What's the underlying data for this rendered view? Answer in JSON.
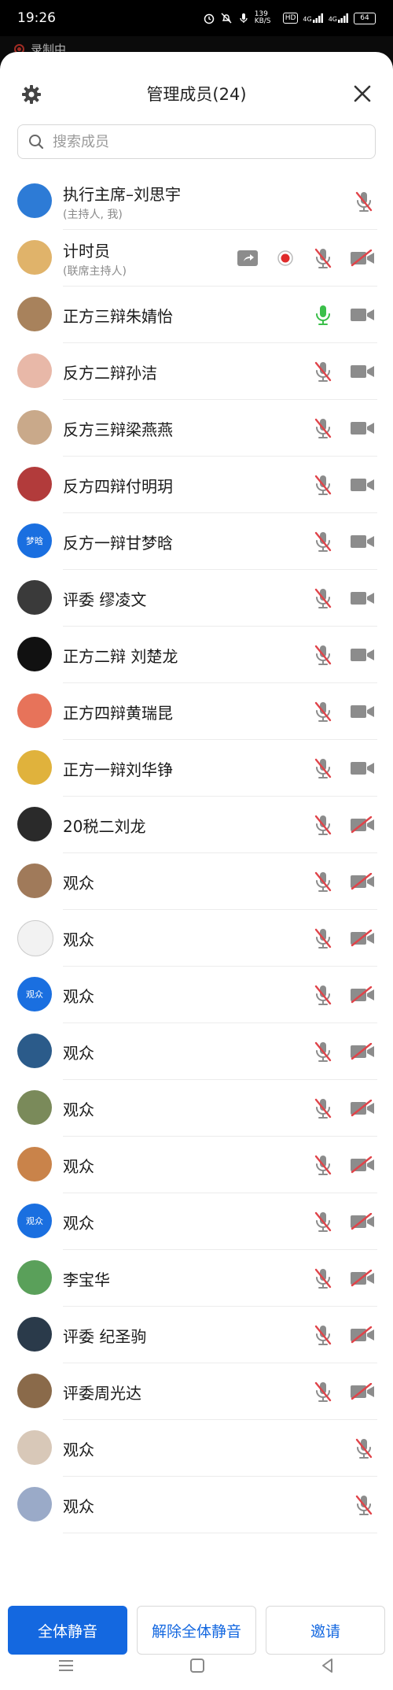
{
  "status_bar": {
    "time": "19:26",
    "net_speed": "139 KB/S",
    "hd": "HD",
    "sig1": "4G",
    "sig2": "4G",
    "battery": "64"
  },
  "recording_label": "录制中",
  "header": {
    "title": "管理成员(24)"
  },
  "search": {
    "placeholder": "搜索成员"
  },
  "members": [
    {
      "name": "执行主席–刘思宇",
      "sub": "(主持人, 我)",
      "avatar": "#2d7bd6",
      "mic": "muted",
      "cam": "none",
      "share": false,
      "rec": false
    },
    {
      "name": "计时员",
      "sub": "(联席主持人)",
      "avatar": "#e0b36a",
      "mic": "muted",
      "cam": "off",
      "share": true,
      "rec": true
    },
    {
      "name": "正方三辩朱婧怡",
      "sub": "",
      "avatar": "#a8825c",
      "mic": "on",
      "cam": "on",
      "share": false,
      "rec": false
    },
    {
      "name": "反方二辩孙洁",
      "sub": "",
      "avatar": "#e8b8a8",
      "mic": "muted",
      "cam": "on",
      "share": false,
      "rec": false
    },
    {
      "name": "反方三辩梁燕燕",
      "sub": "",
      "avatar": "#c9a98a",
      "mic": "muted",
      "cam": "on",
      "share": false,
      "rec": false
    },
    {
      "name": "反方四辩付明玥",
      "sub": "",
      "avatar": "#b23b3b",
      "mic": "muted",
      "cam": "on",
      "share": false,
      "rec": false
    },
    {
      "name": "反方一辩甘梦晗",
      "sub": "",
      "avatar": "#1a6fe0",
      "avatar_text": "梦晗",
      "mic": "muted",
      "cam": "on",
      "share": false,
      "rec": false
    },
    {
      "name": "评委 缪凌文",
      "sub": "",
      "avatar": "#3a3a3a",
      "mic": "muted",
      "cam": "on",
      "share": false,
      "rec": false
    },
    {
      "name": "正方二辩 刘楚龙",
      "sub": "",
      "avatar": "#111111",
      "mic": "muted",
      "cam": "on",
      "share": false,
      "rec": false
    },
    {
      "name": "正方四辩黄瑞昆",
      "sub": "",
      "avatar": "#e7735a",
      "mic": "muted",
      "cam": "on",
      "share": false,
      "rec": false
    },
    {
      "name": "正方一辩刘华铮",
      "sub": "",
      "avatar": "#e0b23c",
      "mic": "muted",
      "cam": "on",
      "share": false,
      "rec": false
    },
    {
      "name": "20税二刘龙",
      "sub": "",
      "avatar": "#2a2a2a",
      "mic": "muted",
      "cam": "off",
      "share": false,
      "rec": false
    },
    {
      "name": "观众",
      "sub": "",
      "avatar": "#a07a5a",
      "mic": "muted",
      "cam": "off",
      "share": false,
      "rec": false
    },
    {
      "name": "观众",
      "sub": "",
      "avatar": "#f2f2f2",
      "mic": "muted",
      "cam": "off",
      "share": false,
      "rec": false
    },
    {
      "name": "观众",
      "sub": "",
      "avatar": "#1a6fe0",
      "avatar_text": "观众",
      "mic": "muted",
      "cam": "off",
      "share": false,
      "rec": false
    },
    {
      "name": "观众",
      "sub": "",
      "avatar": "#2b5b8a",
      "mic": "muted",
      "cam": "off",
      "share": false,
      "rec": false
    },
    {
      "name": "观众",
      "sub": "",
      "avatar": "#7a8a5a",
      "mic": "muted",
      "cam": "off",
      "share": false,
      "rec": false
    },
    {
      "name": "观众",
      "sub": "",
      "avatar": "#c9834a",
      "mic": "muted",
      "cam": "off",
      "share": false,
      "rec": false
    },
    {
      "name": "观众",
      "sub": "",
      "avatar": "#1a6fe0",
      "avatar_text": "观众",
      "mic": "muted",
      "cam": "off",
      "share": false,
      "rec": false
    },
    {
      "name": "李宝华",
      "sub": "",
      "avatar": "#5aa05a",
      "mic": "muted",
      "cam": "off",
      "share": false,
      "rec": false
    },
    {
      "name": "评委 纪圣驹",
      "sub": "",
      "avatar": "#2a3a4a",
      "mic": "muted",
      "cam": "off",
      "share": false,
      "rec": false
    },
    {
      "name": "评委周光达",
      "sub": "",
      "avatar": "#8a6a4a",
      "mic": "muted",
      "cam": "off",
      "share": false,
      "rec": false
    },
    {
      "name": "观众",
      "sub": "",
      "avatar": "#d8c8b8",
      "mic": "muted",
      "cam": "none",
      "share": false,
      "rec": false
    },
    {
      "name": "观众",
      "sub": "",
      "avatar": "#9aaac8",
      "mic": "muted",
      "cam": "none",
      "share": false,
      "rec": false
    }
  ],
  "buttons": {
    "mute_all": "全体静音",
    "unmute_all": "解除全体静音",
    "invite": "邀请"
  },
  "colors": {
    "accent": "#1468e0",
    "mic_on": "#3bbf4a",
    "muted_slash": "#e0444a",
    "icon_gray": "#8c8c8c",
    "record_red": "#e02b2b"
  }
}
